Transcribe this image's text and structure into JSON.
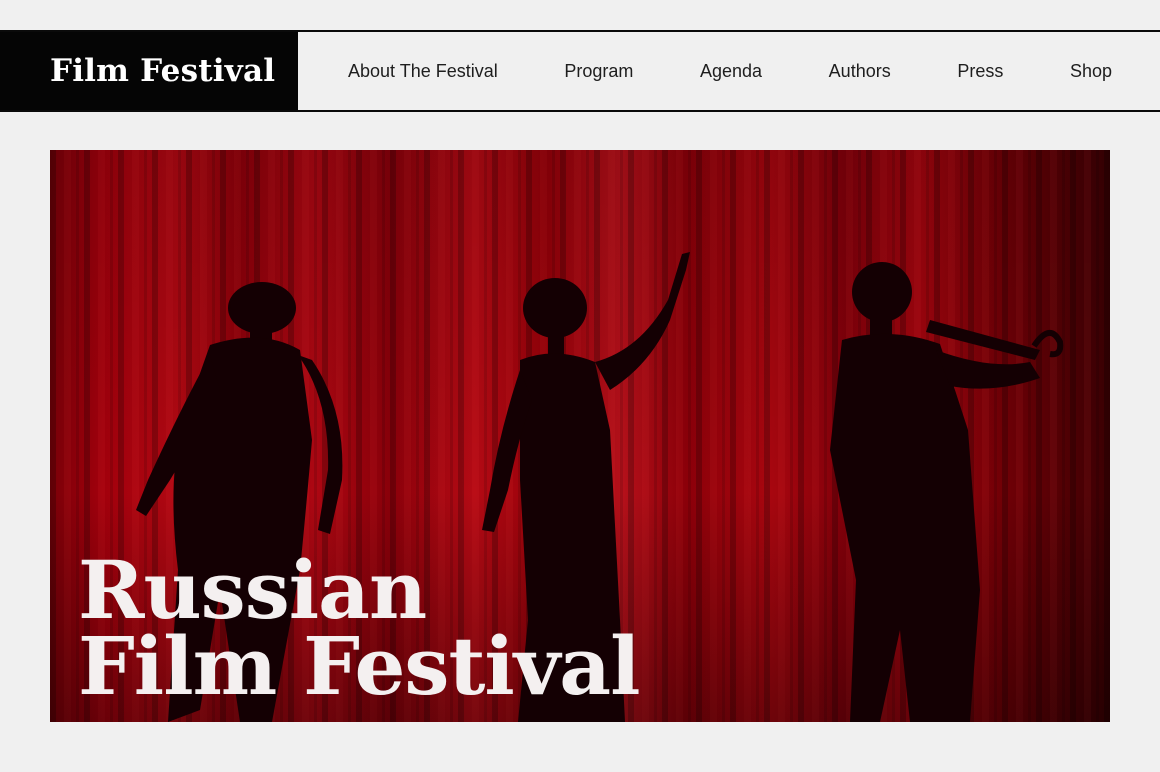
{
  "brand": {
    "logo_text": "Film Festival"
  },
  "nav": {
    "items": [
      {
        "label": "About The Festival"
      },
      {
        "label": "Program"
      },
      {
        "label": "Agenda"
      },
      {
        "label": "Authors"
      },
      {
        "label": "Press"
      },
      {
        "label": "Shop"
      }
    ]
  },
  "hero": {
    "title_line1": "Russian",
    "title_line2": "Film Festival",
    "image": "silhouettes-on-red-curtain-stage"
  },
  "colors": {
    "background": "#f0f0f0",
    "header_logo_bg": "#050505",
    "curtain_red": "#a4000c",
    "hero_text": "#f4f0f0"
  }
}
